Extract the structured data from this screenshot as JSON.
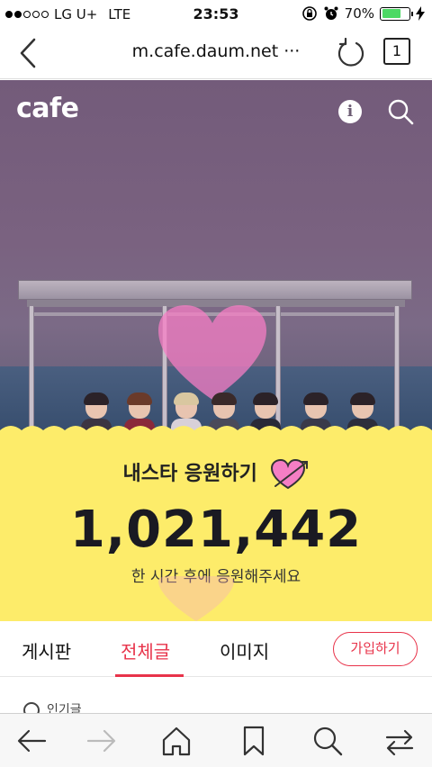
{
  "status": {
    "carrier": "LG U+",
    "network": "LTE",
    "time": "23:53",
    "battery": "70%",
    "battery_level": 0.7,
    "signal_bars": 2,
    "signal_total": 5
  },
  "browser": {
    "domain": "m.cafe.daum.net ···",
    "tab_count": "1"
  },
  "hero": {
    "logo": "cafe",
    "info_glyph": "i"
  },
  "promo": {
    "title": "내스타 응원하기",
    "count": "1,021,442",
    "subtitle": "한 시간 후에 응원해주세요"
  },
  "tabs": [
    {
      "label": "게시판"
    },
    {
      "label": "전체글"
    },
    {
      "label": "이미지"
    }
  ],
  "active_tab": "전체글",
  "join_label": "가입하기",
  "peek_text": "인기글",
  "colors": {
    "accent": "#e8334a",
    "yellow": "#fdec6a",
    "hero_tint": "#735b7a",
    "heart_pink": "#f57ec4"
  }
}
